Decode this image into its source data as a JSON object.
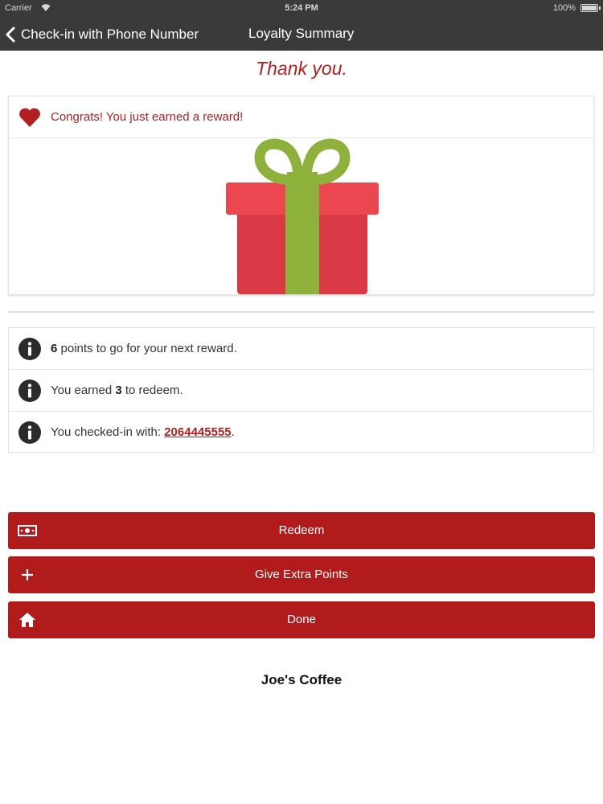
{
  "status_bar": {
    "carrier": "Carrier",
    "time": "5:24 PM",
    "battery": "100%"
  },
  "nav": {
    "back_label": "Check-in with Phone Number",
    "title": "Loyalty Summary"
  },
  "thank_you": "Thank you.",
  "reward": {
    "message": "Congrats! You just earned a reward!",
    "heart_color": "#b21f1f",
    "gift_box_color": "#d93a45",
    "gift_ribbon_color": "#8db13a"
  },
  "info": {
    "points_to_go": "6",
    "points_suffix": " points to go for your next reward.",
    "earned_prefix": "You earned ",
    "earned_count": "3",
    "earned_suffix": " to redeem.",
    "checkin_prefix": "You checked-in with: ",
    "phone": "2064445555",
    "checkin_suffix": "."
  },
  "buttons": {
    "redeem": "Redeem",
    "extra_points": "Give Extra Points",
    "done": "Done",
    "color": "#b21b1b"
  },
  "store_name": "Joe's Coffee"
}
